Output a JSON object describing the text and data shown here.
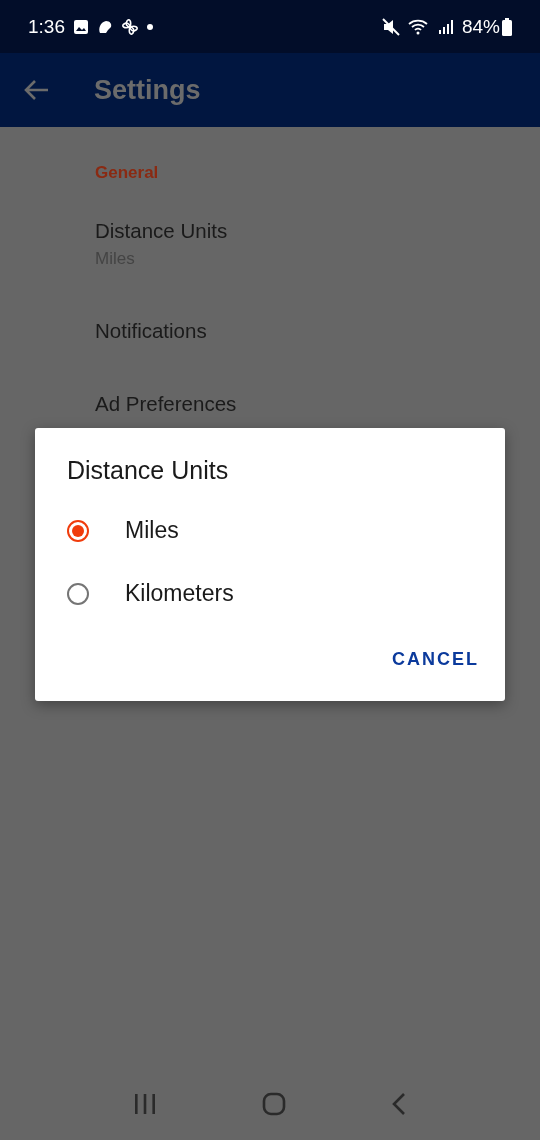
{
  "status_bar": {
    "time": "1:36",
    "battery": "84%"
  },
  "app_bar": {
    "title": "Settings"
  },
  "settings": {
    "section": "General",
    "items": [
      {
        "title": "Distance Units",
        "summary": "Miles"
      },
      {
        "title": "Notifications"
      },
      {
        "title": "Ad Preferences"
      }
    ]
  },
  "dialog": {
    "title": "Distance Units",
    "options": [
      {
        "label": "Miles",
        "selected": true
      },
      {
        "label": "Kilometers",
        "selected": false
      }
    ],
    "buttons": [
      "CANCEL"
    ]
  }
}
